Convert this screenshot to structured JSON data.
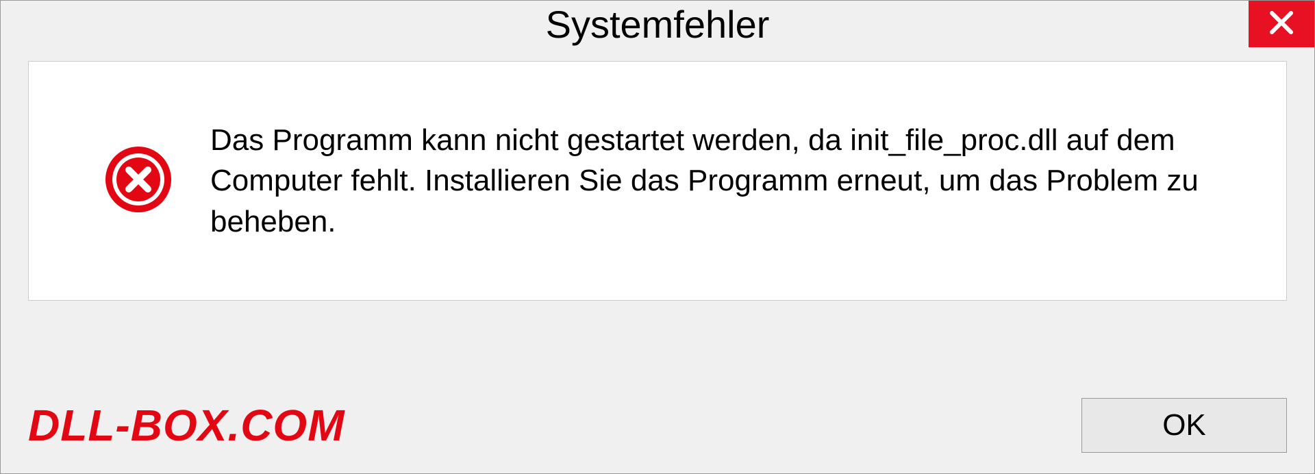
{
  "dialog": {
    "title": "Systemfehler",
    "message": "Das Programm kann nicht gestartet werden, da init_file_proc.dll auf dem Computer fehlt. Installieren Sie das Programm erneut, um das Problem zu beheben.",
    "ok_label": "OK"
  },
  "watermark": "DLL-BOX.COM",
  "colors": {
    "close_bg": "#e81123",
    "error_icon": "#e30613",
    "watermark": "#e30613"
  }
}
